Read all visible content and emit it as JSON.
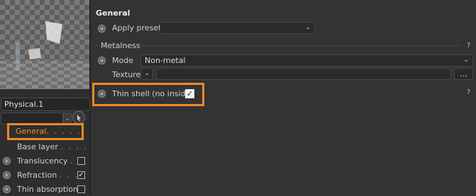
{
  "material": {
    "name": "Physical.1"
  },
  "nav": {
    "items": [
      {
        "label": "General",
        "dots": ". . . . .",
        "has_radio": false,
        "has_checkbox": false,
        "active": true
      },
      {
        "label": "Base layer",
        "dots": ". . . .",
        "has_radio": false,
        "has_checkbox": false,
        "active": false
      },
      {
        "label": "Translucency",
        "dots": ". .",
        "has_radio": true,
        "has_checkbox": true,
        "checked": false
      },
      {
        "label": "Refraction",
        "dots": ". . . .",
        "has_radio": true,
        "has_checkbox": true,
        "checked": true
      },
      {
        "label": "Thin absorption",
        "dots": "",
        "has_radio": true,
        "has_checkbox": true,
        "checked": false
      }
    ],
    "check_glyph": "✓"
  },
  "general": {
    "title": "General",
    "apply_preset_label": "Apply preset",
    "apply_preset_value": "",
    "metalness": {
      "title": "Metalness",
      "help": "?",
      "mode_label": "Mode",
      "mode_value": "Non-metal",
      "texture_label": "Texture",
      "texture_value": "",
      "browse_label": "..."
    },
    "thin_shell": {
      "label": "Thin shell (no inside)",
      "checked": true,
      "check_glyph": "✓",
      "help": "?"
    }
  },
  "colors": {
    "highlight": "#f08a24",
    "background": "#333333"
  },
  "icons": [
    "chevron-down-icon",
    "cursor-icon",
    "checkmark-icon",
    "radio-icon"
  ]
}
